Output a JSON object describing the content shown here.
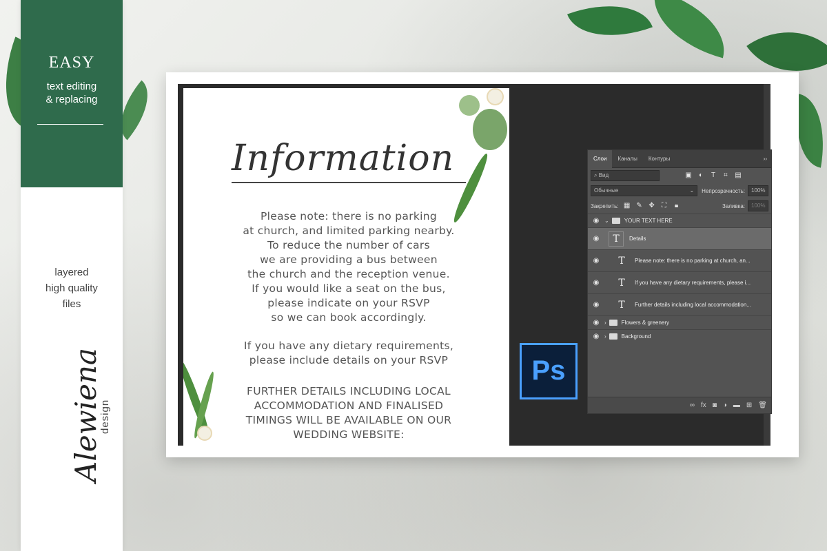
{
  "sidebar": {
    "heading": "EASY",
    "sub_lines": [
      "text editing",
      "& replacing"
    ],
    "feature_lines": [
      "layered",
      "high quality",
      "files"
    ],
    "logo_script": "Alewiena",
    "logo_small": "design",
    "accent_color": "#2f6b4c"
  },
  "card": {
    "title": "Information",
    "paragraph1": [
      "Please note: there is no parking",
      "at church, and limited parking nearby.",
      "To reduce the number of cars",
      "we are providing a bus between",
      "the church and the reception venue.",
      "If you would like a seat on the bus,",
      "please indicate on your RSVP",
      "so we can book accordingly."
    ],
    "paragraph2": [
      "If you have any dietary requirements,",
      "please include details on your RSVP"
    ],
    "paragraph3": [
      "FURTHER DETAILS INCLUDING LOCAL",
      "ACCOMMODATION AND FINALISED",
      "TIMINGS WILL BE AVAILABLE ON OUR",
      "WEDDING WEBSITE:"
    ]
  },
  "photoshop": {
    "logo_text": "Ps",
    "tabs": [
      "Слои",
      "Каналы",
      "Контуры"
    ],
    "collapse_icon": "double-chevron-icon",
    "filter_placeholder": "Вид",
    "blend_mode": "Обычные",
    "opacity_label": "Непрозрачность:",
    "opacity_value": "100%",
    "lock_label": "Закрепить:",
    "fill_label": "Заливка:",
    "fill_value": "100%",
    "layers": [
      {
        "type": "group",
        "name": "YOUR TEXT HERE",
        "expanded": true
      },
      {
        "type": "text",
        "name": "Details",
        "selected": true
      },
      {
        "type": "text",
        "name": "Please note: there is no parking at church, an..."
      },
      {
        "type": "text",
        "name": "If you have any dietary requirements, please i..."
      },
      {
        "type": "text",
        "name": "Further details including local accommodation..."
      },
      {
        "type": "group",
        "name": "Flowers & greenery",
        "expanded": false
      },
      {
        "type": "group",
        "name": "Background",
        "expanded": false
      }
    ]
  }
}
